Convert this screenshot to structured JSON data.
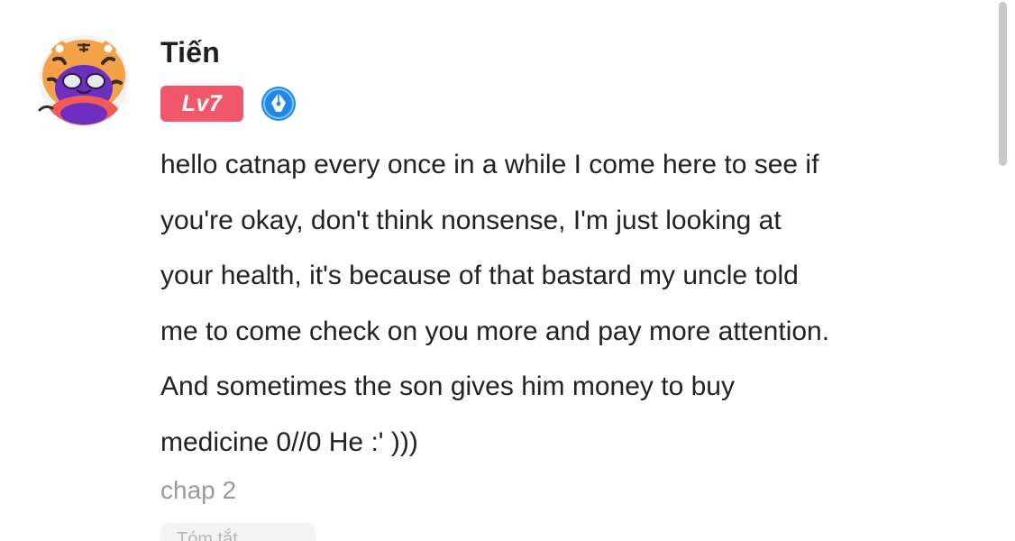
{
  "post": {
    "author": {
      "name": "Tiến",
      "avatar_icon": "tiger-cat-avatar-icon",
      "level_label": "Lv7",
      "level_color": "#f0576a",
      "role_icon": "pen-nib-badge-icon"
    },
    "content_lines": [
      "hello catnap every once in a while I come here to see if",
      "you're okay, don't think nonsense, I'm just looking at",
      "your health, it's because of that bastard my uncle told",
      "me to come check on you more and pay more attention.",
      "And sometimes the son gives him money to buy",
      "medicine 0//0 He :' )))"
    ],
    "tag": "chap 2",
    "translate_label": "Tóm tắt"
  }
}
